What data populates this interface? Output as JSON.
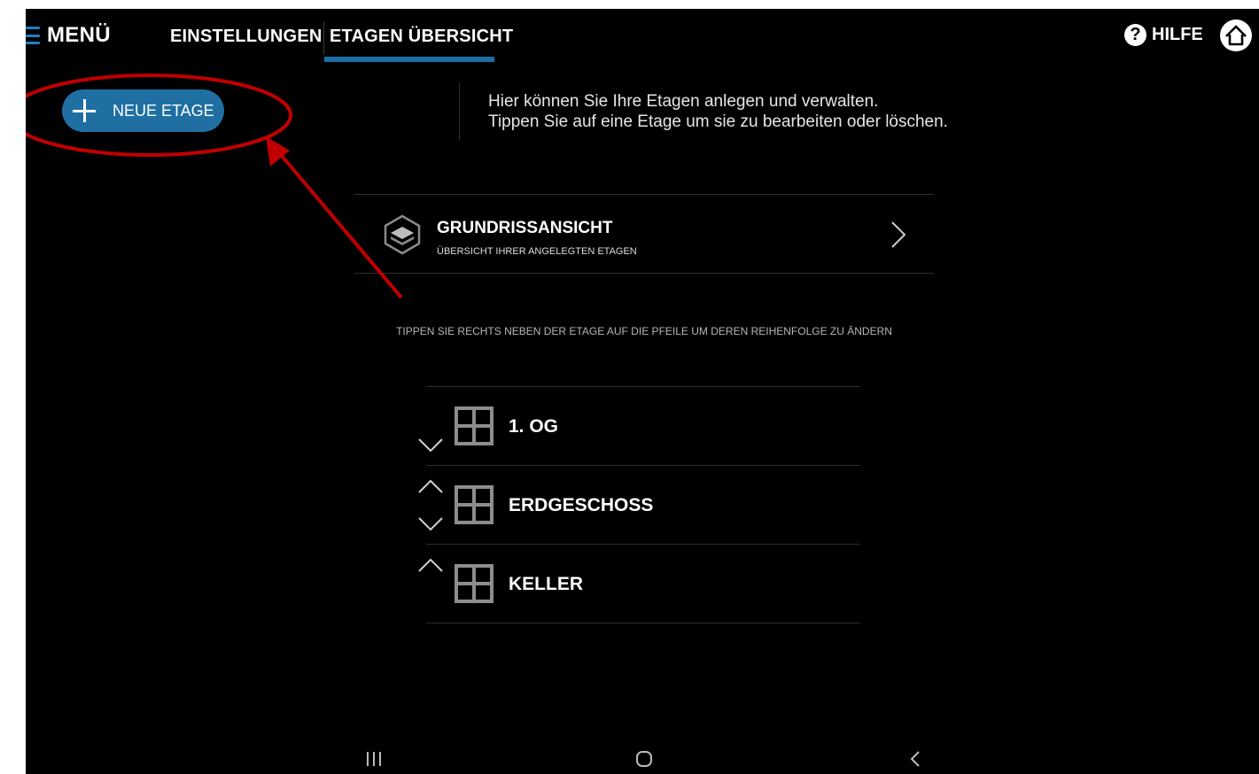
{
  "topbar": {
    "menu_label": "MENÜ",
    "tabs": [
      "EINSTELLUNGEN",
      "ETAGEN ÜBERSICHT"
    ],
    "active_tab": "ETAGEN ÜBERSICHT",
    "help_label": "HILFE",
    "help_icon": "question-circle-icon",
    "home_icon": "home-icon"
  },
  "new_floor_button": {
    "label": "NEUE ETAGE",
    "icon": "plus-icon"
  },
  "info": {
    "line1": "Hier können Sie Ihre Etagen anlegen und verwalten.",
    "line2": "Tippen Sie auf eine Etage um sie zu bearbeiten oder löschen."
  },
  "floorplan_view": {
    "title": "GRUNDRISSANSICHT",
    "subtitle": "ÜBERSICHT IHRER ANGELEGTEN ETAGEN",
    "icon": "layers-icon"
  },
  "order_hint": "TIPPEN SIE RECHTS NEBEN DER ETAGE AUF DIE PFEILE UM DEREN REIHENFOLGE ZU ÄNDERN",
  "floors": [
    {
      "name": "1. OG",
      "up": false,
      "down": true
    },
    {
      "name": "ERDGESCHOSS",
      "up": true,
      "down": true
    },
    {
      "name": "KELLER",
      "up": true,
      "down": false
    }
  ],
  "colors": {
    "accent": "#1f6fa3",
    "background": "#000000",
    "annotation": "#c00000"
  },
  "navbar": [
    "recent-apps-icon",
    "home-circle-icon",
    "back-icon"
  ]
}
